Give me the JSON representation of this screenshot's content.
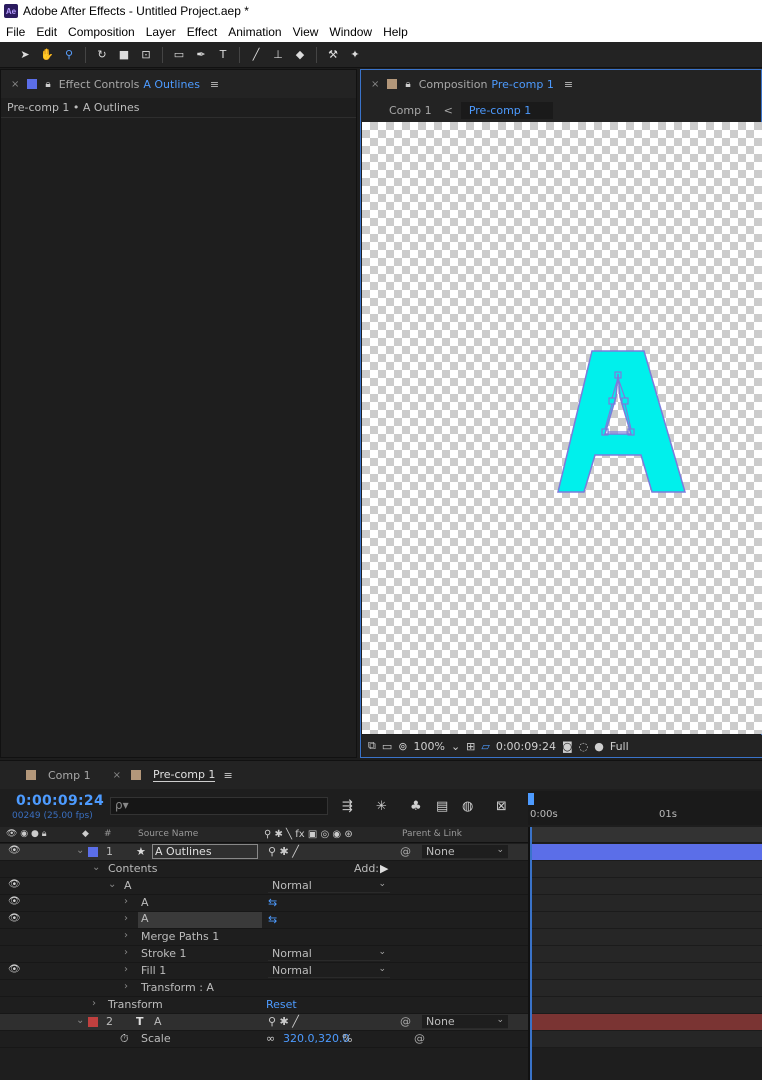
{
  "app": {
    "title": "Adobe After Effects - Untitled Project.aep *",
    "logo_text": "Ae"
  },
  "menu": [
    "File",
    "Edit",
    "Composition",
    "Layer",
    "Effect",
    "Animation",
    "View",
    "Window",
    "Help"
  ],
  "toolbar": {
    "tools": [
      {
        "name": "selection-tool-icon",
        "glyph": "➤",
        "active": false
      },
      {
        "name": "hand-tool-icon",
        "glyph": "✋",
        "active": false
      },
      {
        "name": "zoom-tool-icon",
        "glyph": "⚲",
        "active": true
      },
      {
        "name": "rotate-tool-icon",
        "glyph": "↻",
        "active": false
      },
      {
        "name": "camera-tool-icon",
        "glyph": "■",
        "active": false
      },
      {
        "name": "pan-behind-tool-icon",
        "glyph": "⊡",
        "active": false
      },
      {
        "name": "rectangle-tool-icon",
        "glyph": "▭",
        "active": false
      },
      {
        "name": "pen-tool-icon",
        "glyph": "✒",
        "active": false
      },
      {
        "name": "type-tool-icon",
        "glyph": "T",
        "active": false
      },
      {
        "name": "brush-tool-icon",
        "glyph": "╱",
        "active": false
      },
      {
        "name": "clone-stamp-tool-icon",
        "glyph": "⊥",
        "active": false
      },
      {
        "name": "eraser-tool-icon",
        "glyph": "◆",
        "active": false
      },
      {
        "name": "roto-brush-tool-icon",
        "glyph": "⚒",
        "active": false
      },
      {
        "name": "puppet-tool-icon",
        "glyph": "✦",
        "active": false
      }
    ]
  },
  "effect_controls": {
    "close_glyph": "×",
    "tab_prefix": "Effect Controls",
    "tab_layer": "A Outlines",
    "menu_glyph": "≡",
    "subheader": "Pre-comp 1 • A Outlines",
    "swatch_color": "#5b6ee8"
  },
  "composition": {
    "close_glyph": "×",
    "tab_prefix": "Composition",
    "tab_comp": "Pre-comp 1",
    "menu_glyph": "≡",
    "swatch_color": "#b3977a",
    "breadcrumb": {
      "parent": "Comp 1",
      "sep": "<",
      "current": "Pre-comp 1"
    },
    "letter_fill": "#00f0ec",
    "letter_stroke": "#7b7bdb",
    "footer": {
      "zoom": "100%",
      "timecode": "0:00:09:24",
      "resolution": "Full"
    }
  },
  "timeline": {
    "tabs": [
      {
        "label": "Comp 1",
        "active": false
      },
      {
        "label": "Pre-comp 1",
        "active": true
      }
    ],
    "close_glyph": "×",
    "menu_glyph": "≡",
    "timecode": "0:00:09:24",
    "frame_info": "00249 (25.00 fps)",
    "search_glyph": "ρ▾",
    "ruler": [
      "0:00s",
      "01s"
    ],
    "columns": {
      "num": "#",
      "source": "Source Name",
      "parent": "Parent & Link"
    },
    "rows": {
      "layer1": {
        "num": "1",
        "name": "A Outlines",
        "parent": "None",
        "color": "#5b6ee8"
      },
      "contents": "Contents",
      "add_label": "Add:",
      "group_a": "A",
      "group_a_mode": "Normal",
      "path_a1": "A",
      "path_a2": "A",
      "merge": "Merge Paths 1",
      "stroke": "Stroke 1",
      "stroke_mode": "Normal",
      "fill": "Fill 1",
      "fill_mode": "Normal",
      "transform_a": "Transform : A",
      "transform": "Transform",
      "reset": "Reset",
      "layer2": {
        "num": "2",
        "name": "A",
        "parent": "None",
        "color": "#c0403f"
      },
      "scale": "Scale",
      "scale_value": "320.0,320.0",
      "scale_unit": "%"
    }
  }
}
